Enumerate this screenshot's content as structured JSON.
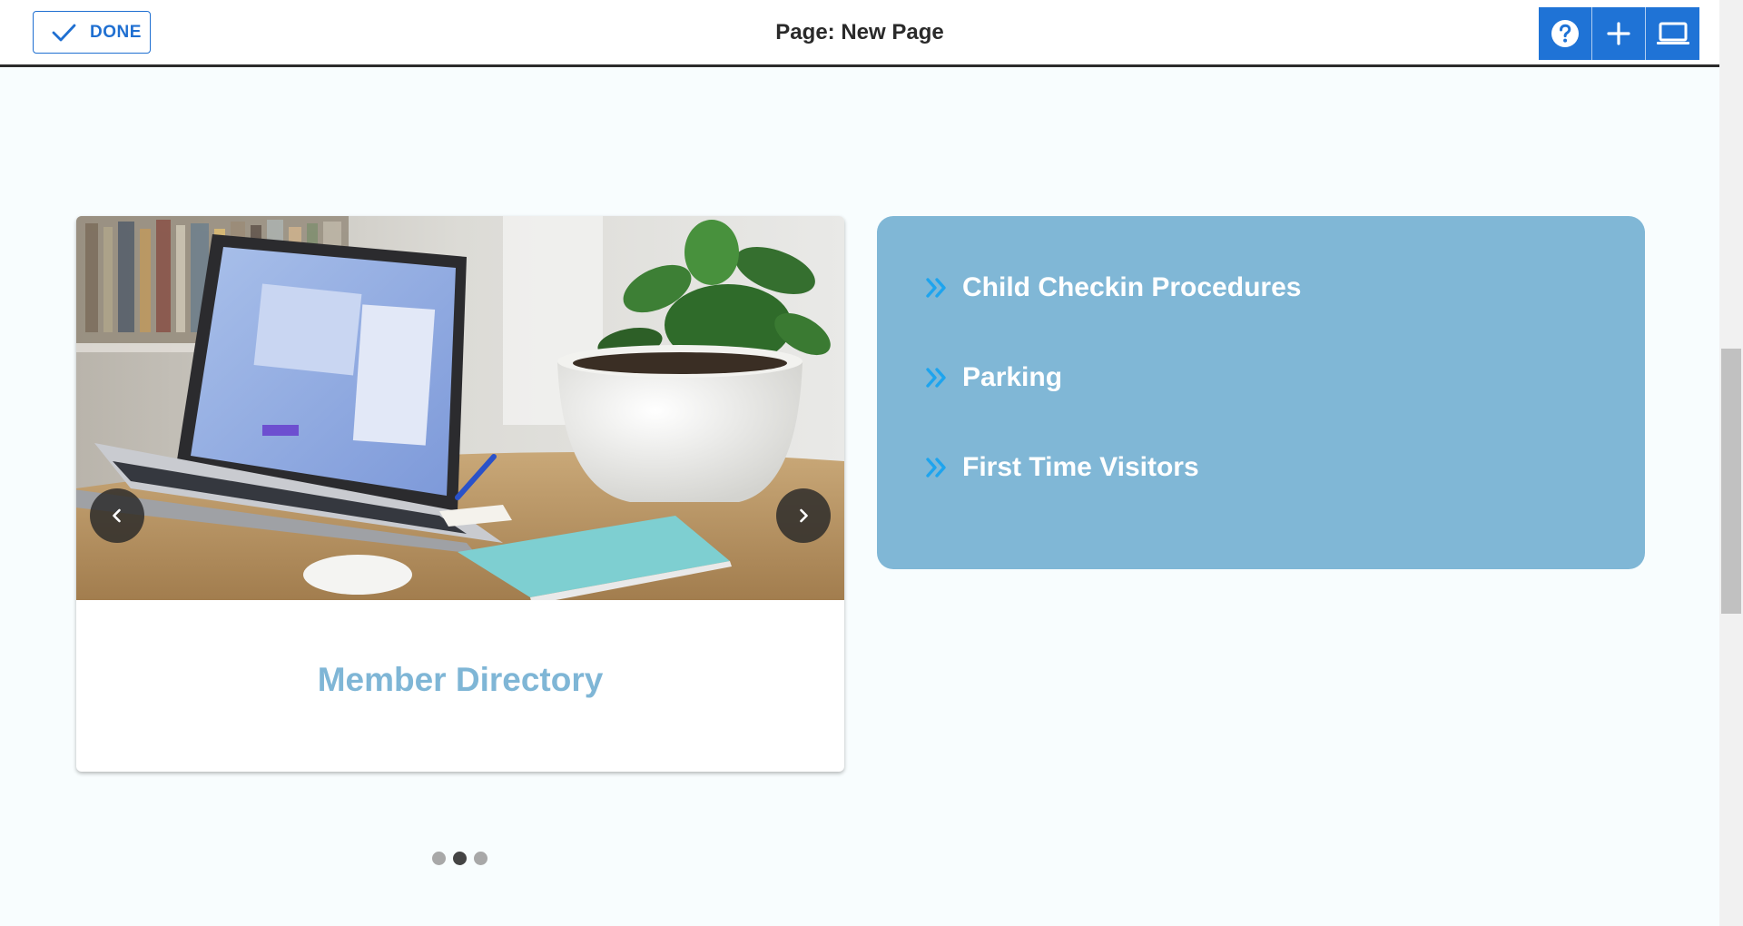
{
  "toolbar": {
    "done_label": "DONE",
    "page_title": "Page: New Page",
    "icons": [
      "help-icon",
      "add-icon",
      "laptop-preview-icon"
    ],
    "accent_color": "#1f73d6"
  },
  "carousel": {
    "slide_caption": "Member Directory",
    "active_slide": 2,
    "slide_count": 3,
    "caption_color": "#7fb6d6"
  },
  "links_panel": {
    "background_color": "#80b7d6",
    "bullet_color": "#1ea4ee",
    "items": [
      {
        "label": "Child Checkin Procedures"
      },
      {
        "label": "Parking"
      },
      {
        "label": "First Time Visitors"
      }
    ]
  }
}
